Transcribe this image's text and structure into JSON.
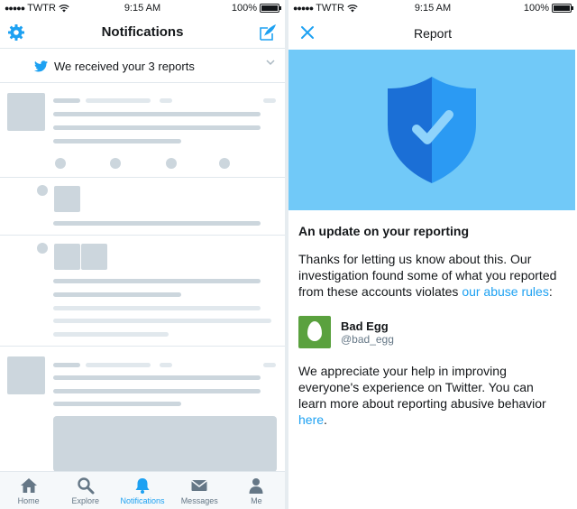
{
  "left": {
    "status": {
      "carrier": "TWTR",
      "time": "9:15 AM",
      "battery": "100%"
    },
    "nav": {
      "title": "Notifications",
      "settings_icon": "gear-icon",
      "compose_icon": "compose-icon"
    },
    "banner": {
      "text": "We received your 3 reports"
    },
    "tabs": [
      {
        "label": "Home",
        "icon": "home-icon"
      },
      {
        "label": "Explore",
        "icon": "search-icon"
      },
      {
        "label": "Notifications",
        "icon": "bell-icon",
        "active": true
      },
      {
        "label": "Messages",
        "icon": "envelope-icon"
      },
      {
        "label": "Me",
        "icon": "person-icon"
      }
    ]
  },
  "right": {
    "status": {
      "carrier": "TWTR",
      "time": "9:15 AM",
      "battery": "100%"
    },
    "nav": {
      "title": "Report",
      "close_icon": "close-icon"
    },
    "hero": {
      "icon": "shield-check-icon",
      "background": "#71c9f8"
    },
    "heading": "An update on your reporting",
    "para1": "Thanks for letting us know about this. Our investigation found some of what you reported from these accounts violates ",
    "para1_link": "our abuse rules",
    "para1_end": ":",
    "account": {
      "name": "Bad Egg",
      "handle": "@bad_egg"
    },
    "para2": "We appreciate your help in improving everyone's experience on Twitter. You can learn more about reporting abusive behavior ",
    "para2_link": "here",
    "para2_end": "."
  },
  "colors": {
    "accent": "#1da1f2",
    "placeholder": "#ccd6dd",
    "shield_dark": "#1b6fd6",
    "shield_light": "#2b9af3"
  }
}
